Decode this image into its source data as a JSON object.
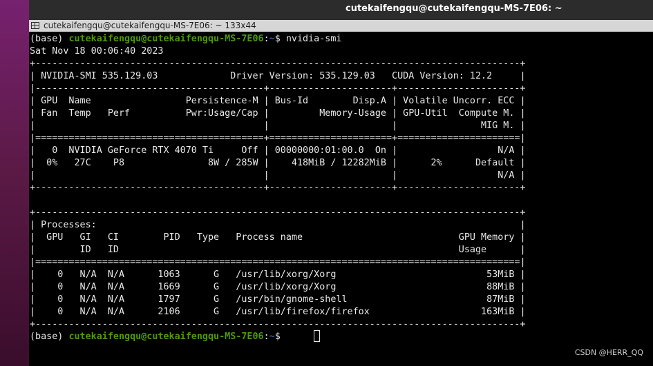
{
  "window": {
    "title": "cutekaifengqu@cutekaifengqu-MS-7E06: ~",
    "terminal_title": "cutekaifengqu@cutekaifengqu-MS-7E06: ~ 133x44"
  },
  "prompt": {
    "base": "(base) ",
    "user_host": "cutekaifengqu@cutekaifengqu-MS-7E06",
    "sep": ":",
    "path": "~",
    "sigil": "$ ",
    "command": "nvidia-smi"
  },
  "output": {
    "date": "Sat Nov 18 00:06:40 2023",
    "gpu_table": [
      "+---------------------------------------------------------------------------------------+",
      "| NVIDIA-SMI 535.129.03             Driver Version: 535.129.03   CUDA Version: 12.2     |",
      "|-----------------------------------------+----------------------+----------------------+",
      "| GPU  Name                 Persistence-M | Bus-Id        Disp.A | Volatile Uncorr. ECC |",
      "| Fan  Temp   Perf          Pwr:Usage/Cap |         Memory-Usage | GPU-Util  Compute M. |",
      "|                                         |                      |               MIG M. |",
      "|=========================================+======================+======================|",
      "|   0  NVIDIA GeForce RTX 4070 Ti     Off | 00000000:01:00.0  On |                  N/A |",
      "|  0%   27C    P8               8W / 285W |    418MiB / 12282MiB |      2%      Default |",
      "|                                         |                      |                  N/A |",
      "+-----------------------------------------+----------------------+----------------------+"
    ],
    "blank": "",
    "proc_table": [
      "+---------------------------------------------------------------------------------------+",
      "| Processes:                                                                            |",
      "|  GPU   GI   CI        PID   Type   Process name                            GPU Memory |",
      "|        ID   ID                                                             Usage      |",
      "|=======================================================================================|",
      "|    0   N/A  N/A      1063      G   /usr/lib/xorg/Xorg                           53MiB |",
      "|    0   N/A  N/A      1669      G   /usr/lib/xorg/Xorg                           88MiB |",
      "|    0   N/A  N/A      1797      G   /usr/bin/gnome-shell                         87MiB |",
      "|    0   N/A  N/A      2106      G   /usr/lib/firefox/firefox                    163MiB |",
      "+---------------------------------------------------------------------------------------+"
    ]
  },
  "watermark": "CSDN @HERR_QQ"
}
